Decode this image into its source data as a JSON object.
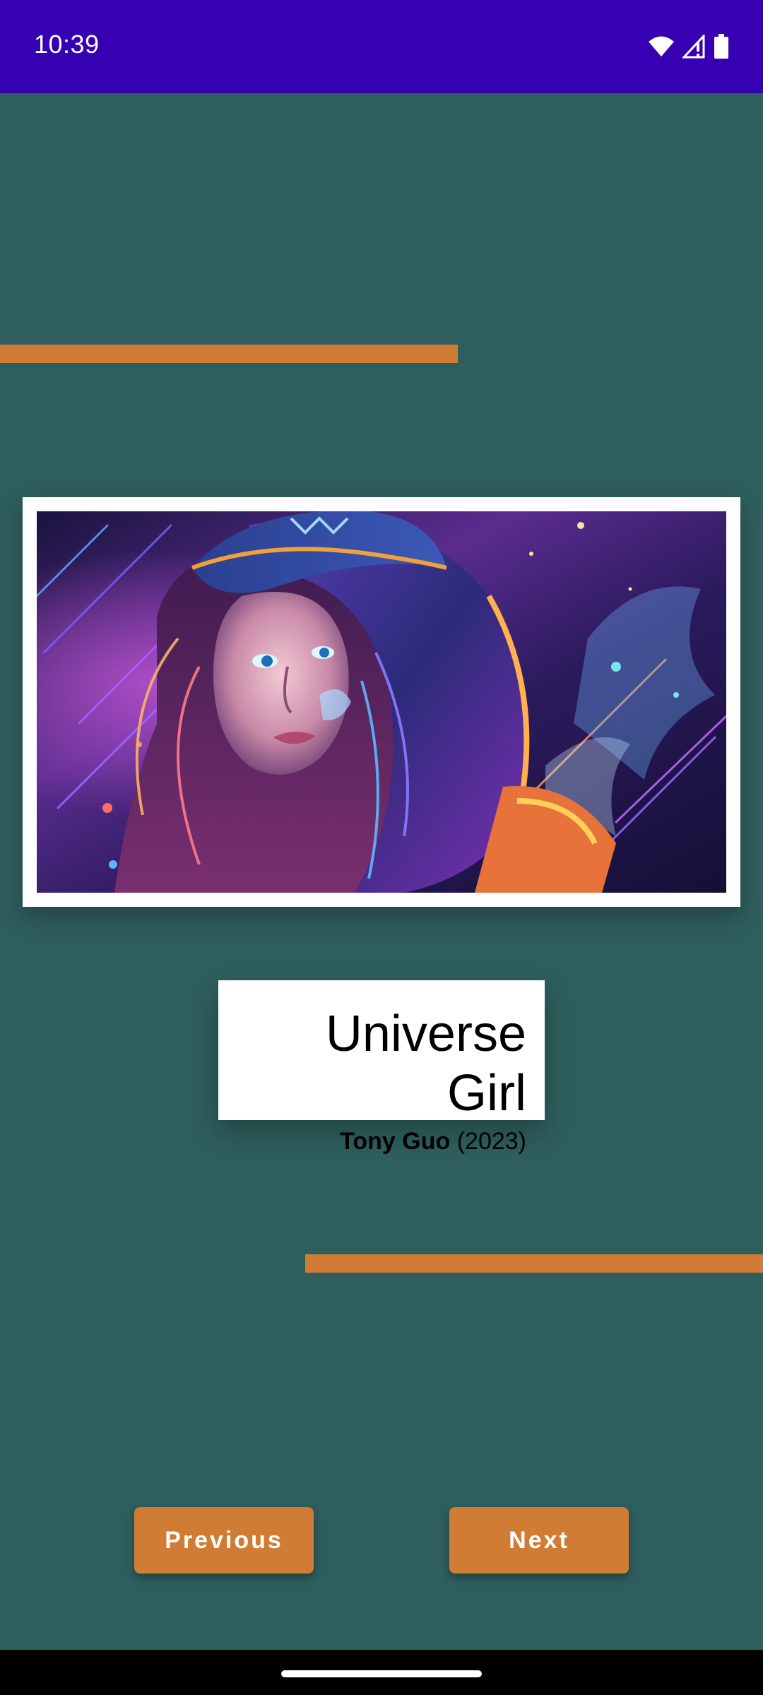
{
  "status_bar": {
    "time": "10:39",
    "background": "#3700b3",
    "icons": [
      "wifi-icon",
      "cellular-signal-icon",
      "battery-icon"
    ]
  },
  "colors": {
    "background": "#2e5e5d",
    "accent": "#d07c35",
    "card": "#ffffff"
  },
  "artwork": {
    "image": "space-girl-in-galaxy-hoodie-illustration",
    "title": "Universe Girl",
    "artist": "Tony Guo",
    "year": "(2023)"
  },
  "controls": {
    "previous_label": "Previous",
    "next_label": "Next"
  }
}
